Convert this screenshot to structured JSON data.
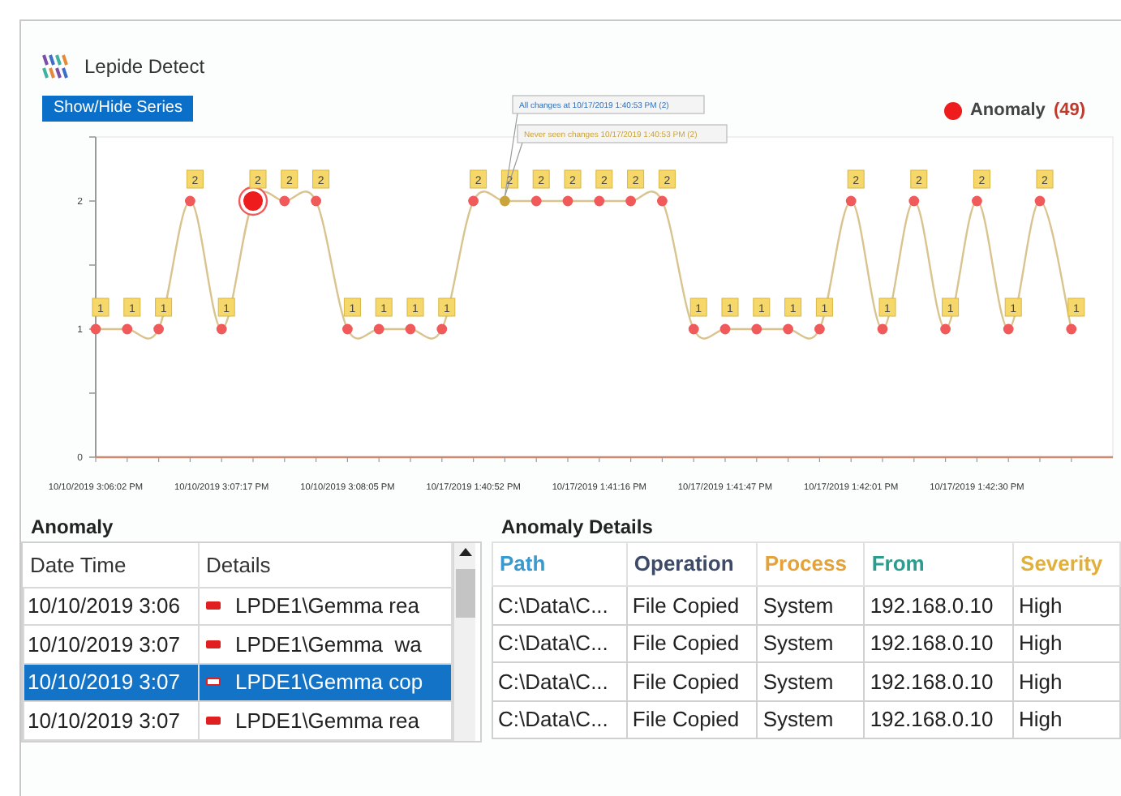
{
  "app": {
    "title": "Lepide Detect"
  },
  "chart": {
    "button": "Show/Hide Series",
    "legend_count": "(49)",
    "chart_data": {
      "type": "line",
      "categories": [
        "10/10/2019 3:06:02 PM",
        null,
        null,
        null,
        "10/10/2019 3:07:17 PM",
        null,
        null,
        null,
        "10/10/2019 3:08:05 PM",
        null,
        null,
        null,
        "10/17/2019 1:40:52 PM",
        null,
        null,
        null,
        "10/17/2019 1:41:16 PM",
        null,
        null,
        null,
        "10/17/2019 1:41:47 PM",
        null,
        null,
        null,
        "10/17/2019 1:42:01 PM",
        null,
        null,
        null,
        "10/17/2019 1:42:30 PM",
        null,
        null,
        null
      ],
      "ylim": [
        0,
        2.5
      ],
      "yticks": [
        0,
        1,
        2
      ],
      "series": [
        {
          "name": "Anomaly",
          "color": "#f05a5a",
          "marker": "circle",
          "values": [
            1,
            1,
            1,
            2,
            1,
            2,
            2,
            2,
            1,
            1,
            1,
            1,
            2,
            2,
            2,
            2,
            2,
            2,
            2,
            1,
            1,
            1,
            1,
            1,
            2,
            1,
            2,
            1,
            2,
            1,
            2,
            1
          ]
        }
      ],
      "data_labels": true,
      "annotations": [
        "All changes at 10/17/2019 1:40:53 PM (2)",
        "Never seen changes 10/17/2019 1:40:53 PM (2)"
      ]
    },
    "points": [
      {
        "selected": false,
        "hovered": false
      },
      {
        "selected": false,
        "hovered": false
      },
      {
        "selected": false,
        "hovered": false
      },
      {
        "selected": false,
        "hovered": false
      },
      {
        "selected": false,
        "hovered": false
      },
      {
        "selected": true,
        "hovered": false
      },
      {
        "selected": false,
        "hovered": false
      },
      {
        "selected": false,
        "hovered": false
      },
      {
        "selected": false,
        "hovered": false
      },
      {
        "selected": false,
        "hovered": false
      },
      {
        "selected": false,
        "hovered": false
      },
      {
        "selected": false,
        "hovered": false
      },
      {
        "selected": false,
        "hovered": false
      },
      {
        "selected": false,
        "hovered": true
      },
      {
        "selected": false,
        "hovered": false
      },
      {
        "selected": false,
        "hovered": false
      },
      {
        "selected": false,
        "hovered": false
      },
      {
        "selected": false,
        "hovered": false
      },
      {
        "selected": false,
        "hovered": false
      },
      {
        "selected": false,
        "hovered": false
      },
      {
        "selected": false,
        "hovered": false
      },
      {
        "selected": false,
        "hovered": false
      },
      {
        "selected": false,
        "hovered": false
      },
      {
        "selected": false,
        "hovered": false
      },
      {
        "selected": false,
        "hovered": false
      },
      {
        "selected": false,
        "hovered": false
      },
      {
        "selected": false,
        "hovered": false
      },
      {
        "selected": false,
        "hovered": false
      },
      {
        "selected": false,
        "hovered": false
      },
      {
        "selected": false,
        "hovered": false
      },
      {
        "selected": false,
        "hovered": false
      },
      {
        "selected": false,
        "hovered": false
      }
    ]
  },
  "anomaly": {
    "title": "Anomaly",
    "columns": [
      "Date Time",
      "Details"
    ],
    "rows": [
      {
        "date_time": "10/10/2019 3:06",
        "details": "LPDE1\\Gemma rea",
        "selected": false
      },
      {
        "date_time": "10/10/2019 3:07",
        "details": "LPDE1\\Gemma  wa",
        "selected": false
      },
      {
        "date_time": "10/10/2019 3:07",
        "details": "LPDE1\\Gemma cop",
        "selected": true
      },
      {
        "date_time": "10/10/2019 3:07",
        "details": "LPDE1\\Gemma rea",
        "selected": false
      }
    ]
  },
  "anomaly_details": {
    "title": "Anomaly Details",
    "columns": [
      {
        "label": "Path",
        "color": "#3a9ad0"
      },
      {
        "label": "Operation",
        "color": "#3d4a68"
      },
      {
        "label": "Process",
        "color": "#e3a23a"
      },
      {
        "label": "From",
        "color": "#2a9d8f"
      },
      {
        "label": "Severity",
        "color": "#e0b03a"
      }
    ],
    "rows": [
      [
        "C:\\Data\\C...",
        "File Copied",
        "System",
        "192.168.0.10",
        "High"
      ],
      [
        "C:\\Data\\C...",
        "File Copied",
        "System",
        "192.168.0.10",
        "High"
      ],
      [
        "C:\\Data\\C...",
        "File Copied",
        "System",
        "192.168.0.10",
        "High"
      ],
      [
        "C:\\Data\\C...",
        "File Copied",
        "System",
        "192.168.0.10",
        "High"
      ]
    ]
  }
}
